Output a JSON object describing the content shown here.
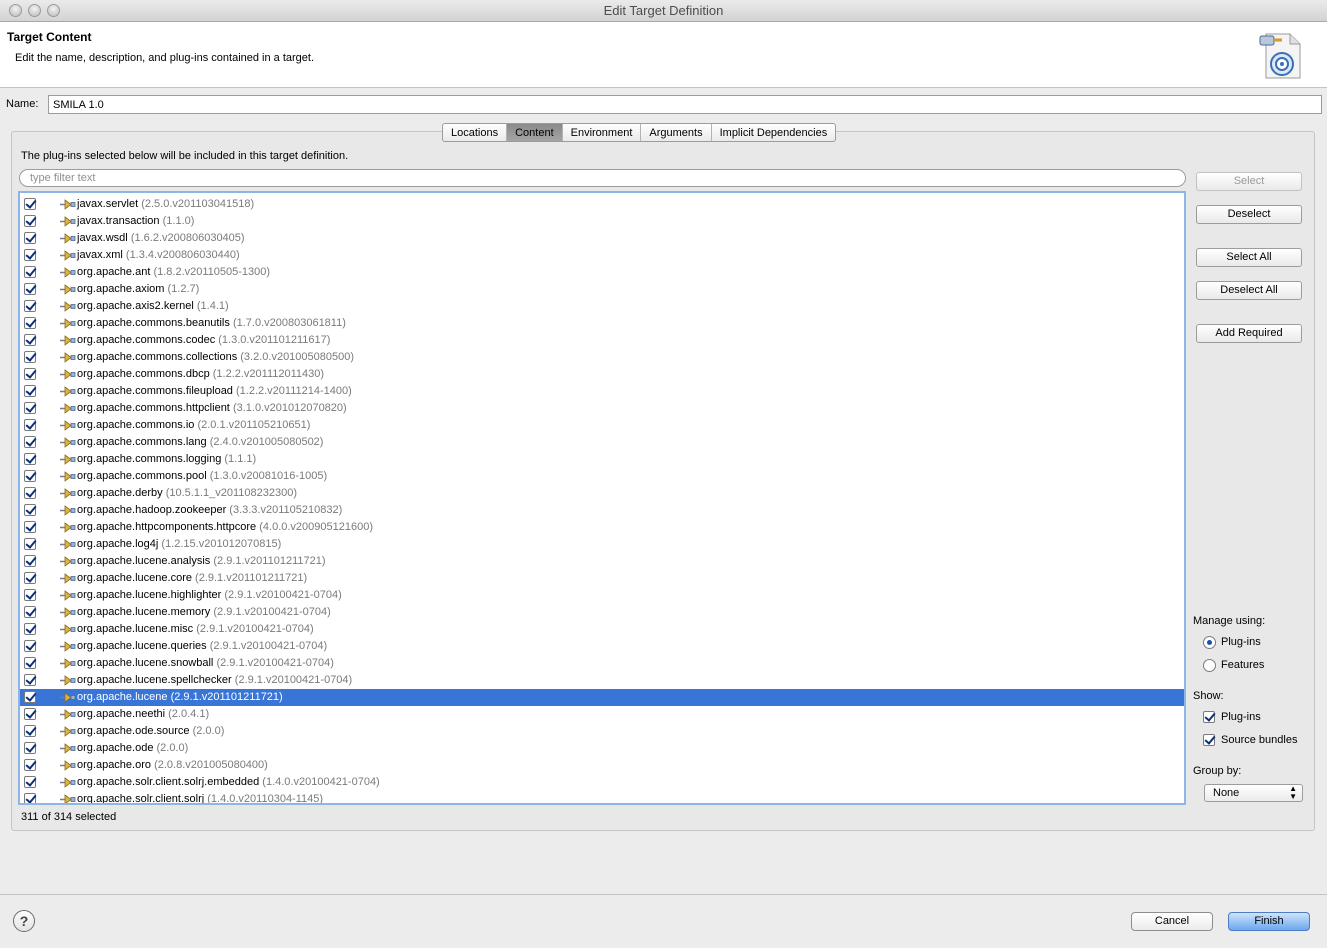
{
  "window": {
    "title": "Edit Target Definition"
  },
  "header": {
    "title": "Target Content",
    "description": "Edit the name, description, and plug-ins contained in a target."
  },
  "name_field": {
    "label": "Name:",
    "value": "SMILA 1.0"
  },
  "tabs": [
    {
      "label": "Locations",
      "active": false
    },
    {
      "label": "Content",
      "active": true
    },
    {
      "label": "Environment",
      "active": false
    },
    {
      "label": "Arguments",
      "active": false
    },
    {
      "label": "Implicit Dependencies",
      "active": false
    }
  ],
  "content": {
    "intro": "The plug-ins selected below will be included in this target definition.",
    "filter_placeholder": "type filter text",
    "plugins": [
      {
        "name": "javax.servlet",
        "version": "(2.5.0.v201103041518)",
        "checked": true
      },
      {
        "name": "javax.transaction",
        "version": "(1.1.0)",
        "checked": true
      },
      {
        "name": "javax.wsdl",
        "version": "(1.6.2.v200806030405)",
        "checked": true
      },
      {
        "name": "javax.xml",
        "version": "(1.3.4.v200806030440)",
        "checked": true
      },
      {
        "name": "org.apache.ant",
        "version": "(1.8.2.v20110505-1300)",
        "checked": true
      },
      {
        "name": "org.apache.axiom",
        "version": "(1.2.7)",
        "checked": true
      },
      {
        "name": "org.apache.axis2.kernel",
        "version": "(1.4.1)",
        "checked": true
      },
      {
        "name": "org.apache.commons.beanutils",
        "version": "(1.7.0.v200803061811)",
        "checked": true
      },
      {
        "name": "org.apache.commons.codec",
        "version": "(1.3.0.v201101211617)",
        "checked": true
      },
      {
        "name": "org.apache.commons.collections",
        "version": "(3.2.0.v201005080500)",
        "checked": true
      },
      {
        "name": "org.apache.commons.dbcp",
        "version": "(1.2.2.v201112011430)",
        "checked": true
      },
      {
        "name": "org.apache.commons.fileupload",
        "version": "(1.2.2.v20111214-1400)",
        "checked": true
      },
      {
        "name": "org.apache.commons.httpclient",
        "version": "(3.1.0.v201012070820)",
        "checked": true
      },
      {
        "name": "org.apache.commons.io",
        "version": "(2.0.1.v201105210651)",
        "checked": true
      },
      {
        "name": "org.apache.commons.lang",
        "version": "(2.4.0.v201005080502)",
        "checked": true
      },
      {
        "name": "org.apache.commons.logging",
        "version": "(1.1.1)",
        "checked": true
      },
      {
        "name": "org.apache.commons.pool",
        "version": "(1.3.0.v20081016-1005)",
        "checked": true
      },
      {
        "name": "org.apache.derby",
        "version": "(10.5.1.1_v201108232300)",
        "checked": true
      },
      {
        "name": "org.apache.hadoop.zookeeper",
        "version": "(3.3.3.v201105210832)",
        "checked": true
      },
      {
        "name": "org.apache.httpcomponents.httpcore",
        "version": "(4.0.0.v200905121600)",
        "checked": true
      },
      {
        "name": "org.apache.log4j",
        "version": "(1.2.15.v201012070815)",
        "checked": true
      },
      {
        "name": "org.apache.lucene.analysis",
        "version": "(2.9.1.v201101211721)",
        "checked": true
      },
      {
        "name": "org.apache.lucene.core",
        "version": "(2.9.1.v201101211721)",
        "checked": true
      },
      {
        "name": "org.apache.lucene.highlighter",
        "version": "(2.9.1.v20100421-0704)",
        "checked": true
      },
      {
        "name": "org.apache.lucene.memory",
        "version": "(2.9.1.v20100421-0704)",
        "checked": true
      },
      {
        "name": "org.apache.lucene.misc",
        "version": "(2.9.1.v20100421-0704)",
        "checked": true
      },
      {
        "name": "org.apache.lucene.queries",
        "version": "(2.9.1.v20100421-0704)",
        "checked": true
      },
      {
        "name": "org.apache.lucene.snowball",
        "version": "(2.9.1.v20100421-0704)",
        "checked": true
      },
      {
        "name": "org.apache.lucene.spellchecker",
        "version": "(2.9.1.v20100421-0704)",
        "checked": true
      },
      {
        "name": "org.apache.lucene",
        "version": "(2.9.1.v201101211721)",
        "checked": true,
        "selected": true
      },
      {
        "name": "org.apache.neethi",
        "version": "(2.0.4.1)",
        "checked": true
      },
      {
        "name": "org.apache.ode.source",
        "version": "(2.0.0)",
        "checked": true
      },
      {
        "name": "org.apache.ode",
        "version": "(2.0.0)",
        "checked": true
      },
      {
        "name": "org.apache.oro",
        "version": "(2.0.8.v201005080400)",
        "checked": true
      },
      {
        "name": "org.apache.solr.client.solrj.embedded",
        "version": "(1.4.0.v20100421-0704)",
        "checked": true
      },
      {
        "name": "org.apache.solr.client.solrj",
        "version": "(1.4.0.v20110304-1145)",
        "checked": true
      }
    ],
    "status": "311 of 314 selected"
  },
  "side_buttons": {
    "select": "Select",
    "deselect": "Deselect",
    "select_all": "Select All",
    "deselect_all": "Deselect All",
    "add_required": "Add Required"
  },
  "manage": {
    "label": "Manage using:",
    "plugins": "Plug-ins",
    "features": "Features",
    "selected": "Plug-ins"
  },
  "show": {
    "label": "Show:",
    "plugins": "Plug-ins",
    "source_bundles": "Source bundles"
  },
  "group_by": {
    "label": "Group by:",
    "value": "None"
  },
  "footer": {
    "cancel": "Cancel",
    "finish": "Finish"
  },
  "colors": {
    "selection": "#3875d7",
    "version_text": "#7a7a7a",
    "default_button": "#6aa8ee"
  }
}
